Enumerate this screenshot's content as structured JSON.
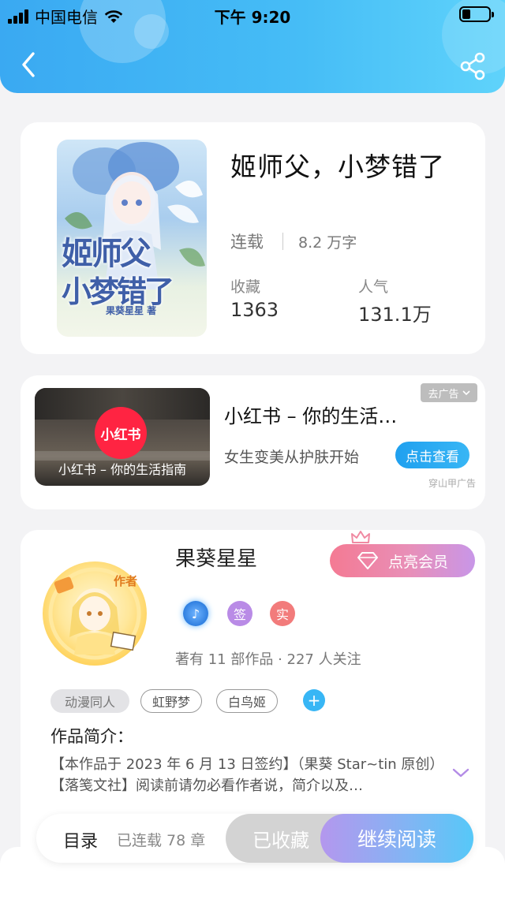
{
  "status_bar": {
    "carrier": "中国电信",
    "time": "下午 9:20"
  },
  "header": {
    "back_icon": "chevron-left-icon",
    "share_icon": "share-icon"
  },
  "book": {
    "title": "姬师父，小梦错了",
    "status": "连载",
    "words": "8.2 万字",
    "favorites_label": "收藏",
    "favorites_value": "1363",
    "popularity_label": "人气",
    "popularity_value": "131.1万",
    "cover_title_line1": "姬师父",
    "cover_title_line2": "小梦错了",
    "cover_author": "果葵星星 著"
  },
  "ad": {
    "image_caption": "小红书 – 你的生活指南",
    "logo_text": "小红书",
    "title": "小红书 – 你的生活…",
    "description": "女生变美从护肤开始",
    "cta": "点击查看",
    "close_label": "去广告",
    "source": "穿山甲广告"
  },
  "author": {
    "name": "果葵星星",
    "avatar_tag": "作者",
    "vip_button": "点亮会员",
    "badges": [
      {
        "icon": "music-note-icon",
        "text": "♪",
        "color": "#3a8fe8"
      },
      {
        "icon": "signed-badge",
        "text": "签",
        "color": "#b98be6"
      },
      {
        "icon": "verified-badge",
        "text": "实",
        "color": "#f27b7b"
      }
    ],
    "stats": "著有 11 部作品 · 227 人关注",
    "tags": [
      "动漫同人",
      "虹野梦",
      "白鸟姬"
    ],
    "intro_label": "作品简介：",
    "intro_text": "【本作品于 2023 年 6 月 13 日签约】（果葵 Star~tin 原创）【落笺文社】阅读前请勿必看作者说，简介以及…"
  },
  "bottom": {
    "toc": "目录",
    "chapters": "已连载 78 章",
    "collected": "已收藏",
    "continue": "继续阅读"
  },
  "colors": {
    "accent": "#3aa9f2",
    "vip_pink": "#f47a93",
    "xhs_red": "#ff2442"
  }
}
